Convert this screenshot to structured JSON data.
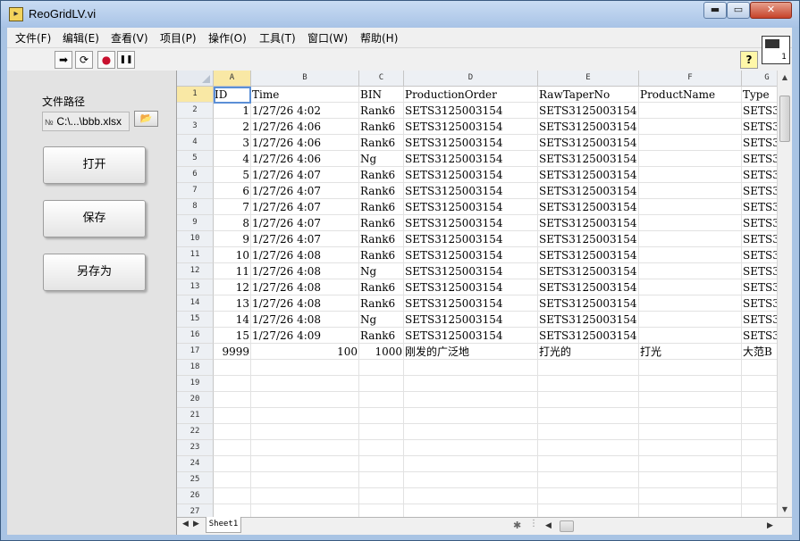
{
  "window": {
    "title": "ReoGridLV.vi",
    "minimize": "▬",
    "maximize": "▭",
    "close": "✕"
  },
  "menu": [
    "文件(F)",
    "编辑(E)",
    "查看(V)",
    "项目(P)",
    "操作(O)",
    "工具(T)",
    "窗口(W)",
    "帮助(H)"
  ],
  "toolbar": {
    "run_icon": "➡",
    "run_continuous_icon": "⟳",
    "abort_icon": "●",
    "pause_icon": "❚❚",
    "help_icon": "?",
    "vi_icon_number": "1"
  },
  "panel": {
    "path_label": "文件路径",
    "path_value": "C:\\...\\bbb.xlsx",
    "path_icon": "№",
    "browse_icon": "📂",
    "open_button": "打开",
    "save_button": "保存",
    "save_as_button": "另存为"
  },
  "sheet": {
    "column_headers": [
      "A",
      "B",
      "C",
      "D",
      "E",
      "F",
      "G"
    ],
    "row_numbers": [
      "1",
      "2",
      "3",
      "4",
      "5",
      "6",
      "7",
      "8",
      "9",
      "10",
      "11",
      "12",
      "13",
      "14",
      "15",
      "16",
      "17",
      "18",
      "19",
      "20",
      "21",
      "22",
      "23",
      "24",
      "25",
      "26",
      "27"
    ],
    "header_row": [
      "ID",
      "Time",
      "BIN",
      "ProductionOrder",
      "RawTaperNo",
      "ProductName",
      "Type"
    ],
    "rows": [
      [
        "1",
        "1/27/26 4:02",
        "Rank6",
        "SETS3125003154",
        "SETS3125003154",
        "",
        "SETS3"
      ],
      [
        "2",
        "1/27/26 4:06",
        "Rank6",
        "SETS3125003154",
        "SETS3125003154",
        "",
        "SETS3"
      ],
      [
        "3",
        "1/27/26 4:06",
        "Rank6",
        "SETS3125003154",
        "SETS3125003154",
        "",
        "SETS3"
      ],
      [
        "4",
        "1/27/26 4:06",
        "Ng",
        "SETS3125003154",
        "SETS3125003154",
        "",
        "SETS3"
      ],
      [
        "5",
        "1/27/26 4:07",
        "Rank6",
        "SETS3125003154",
        "SETS3125003154",
        "",
        "SETS3"
      ],
      [
        "6",
        "1/27/26 4:07",
        "Rank6",
        "SETS3125003154",
        "SETS3125003154",
        "",
        "SETS3"
      ],
      [
        "7",
        "1/27/26 4:07",
        "Rank6",
        "SETS3125003154",
        "SETS3125003154",
        "",
        "SETS3"
      ],
      [
        "8",
        "1/27/26 4:07",
        "Rank6",
        "SETS3125003154",
        "SETS3125003154",
        "",
        "SETS3"
      ],
      [
        "9",
        "1/27/26 4:07",
        "Rank6",
        "SETS3125003154",
        "SETS3125003154",
        "",
        "SETS3"
      ],
      [
        "10",
        "1/27/26 4:08",
        "Rank6",
        "SETS3125003154",
        "SETS3125003154",
        "",
        "SETS3"
      ],
      [
        "11",
        "1/27/26 4:08",
        "Ng",
        "SETS3125003154",
        "SETS3125003154",
        "",
        "SETS3"
      ],
      [
        "12",
        "1/27/26 4:08",
        "Rank6",
        "SETS3125003154",
        "SETS3125003154",
        "",
        "SETS3"
      ],
      [
        "13",
        "1/27/26 4:08",
        "Rank6",
        "SETS3125003154",
        "SETS3125003154",
        "",
        "SETS3"
      ],
      [
        "14",
        "1/27/26 4:08",
        "Ng",
        "SETS3125003154",
        "SETS3125003154",
        "",
        "SETS3"
      ],
      [
        "15",
        "1/27/26 4:09",
        "Rank6",
        "SETS3125003154",
        "SETS3125003154",
        "",
        "SETS3"
      ],
      [
        "9999",
        "100",
        "1000",
        "刚发的广泛地",
        "打光的",
        "打光",
        "大范B"
      ]
    ],
    "sheet_tab": "Sheet1",
    "tab_nav_prev": "◀",
    "tab_nav_next": "▶",
    "scroll_up": "▲",
    "scroll_down": "▼",
    "scroll_left": "◀",
    "scroll_right": "▶"
  }
}
